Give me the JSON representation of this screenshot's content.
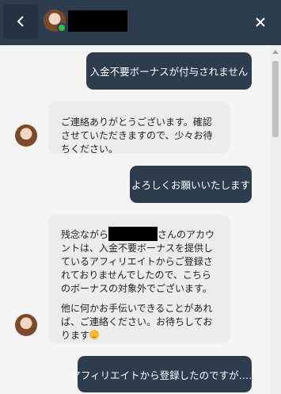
{
  "header": {
    "back_icon": "chevron-left-icon",
    "close_icon": "close-icon",
    "agent_status": "online",
    "colors": {
      "header_bg": "#2e3d4e",
      "online": "#31c24a"
    }
  },
  "messages": {
    "m1": "入金不要ボーナスが付与されません",
    "m2": "ご連絡ありがとうございます。確認させていただきますので、少々お待ちください。",
    "m3": "よろしくお願いいたします",
    "m4_part1": "残念ながら",
    "m4_part2": "さんのアカウントは、入金不要ボーナスを提供しているアフィリエイトからご登録されておりませんでしたので、こちらのボーナスの対象外でございます。",
    "m4_part3": "他に何かお手伝いできることがあれば、ご連絡ください。お待ちしております",
    "m5": "アフィリエイトから登録したのですが……"
  },
  "colors": {
    "user_bubble": "#2e3d4e",
    "agent_bubble": "#ececec",
    "background": "#f4f4f4"
  }
}
